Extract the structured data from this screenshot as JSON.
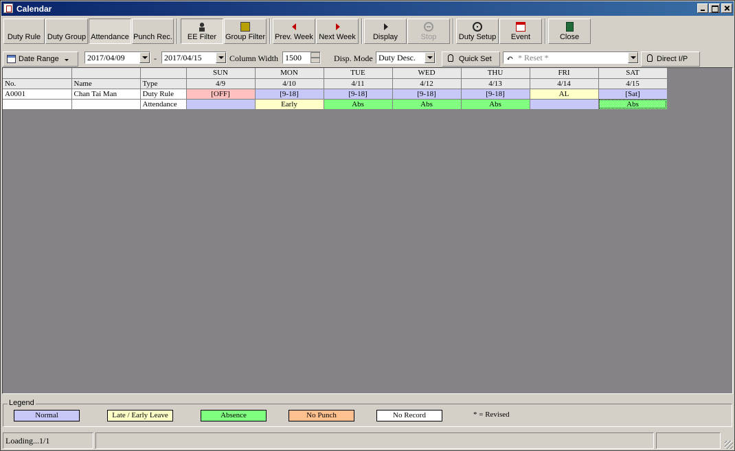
{
  "window": {
    "title": "Calendar"
  },
  "toolbar": {
    "duty_rule": "Duty Rule",
    "duty_group": "Duty Group",
    "attendance": "Attendance",
    "punch_rec": "Punch Rec.",
    "ee_filter": "EE Filter",
    "group_filter": "Group Filter",
    "prev_week": "Prev. Week",
    "next_week": "Next Week",
    "display": "Display",
    "stop": "Stop",
    "duty_setup": "Duty Setup",
    "event": "Event",
    "close": "Close"
  },
  "filters": {
    "date_range": "Date Range",
    "date_from": "2017/04/09",
    "date_sep": "-",
    "date_to": "2017/04/15",
    "column_width_label": "Column Width",
    "column_width": "1500",
    "disp_mode_label": "Disp. Mode",
    "disp_mode": "Duty Desc.",
    "quick_set": "Quick Set",
    "reset": "* Reset *",
    "direct_ip": "Direct I/P"
  },
  "grid": {
    "header_labels": {
      "no": "No.",
      "name": "Name",
      "type": "Type"
    },
    "days": [
      {
        "dow": "SUN",
        "date": "4/9"
      },
      {
        "dow": "MON",
        "date": "4/10"
      },
      {
        "dow": "TUE",
        "date": "4/11"
      },
      {
        "dow": "WED",
        "date": "4/12"
      },
      {
        "dow": "THU",
        "date": "4/13"
      },
      {
        "dow": "FRI",
        "date": "4/14"
      },
      {
        "dow": "SAT",
        "date": "4/15"
      }
    ],
    "employee": {
      "no": "A0001",
      "name": "Chan Tai Man",
      "duty_rule_label": "Duty Rule",
      "attendance_label": "Attendance",
      "duty_rule": [
        "[OFF]",
        "[9-18]",
        "[9-18]",
        "[9-18]",
        "[9-18]",
        "AL",
        "[Sat]"
      ],
      "attendance": [
        "",
        "Early",
        "Abs",
        "Abs",
        "Abs",
        "",
        "Abs"
      ]
    }
  },
  "legend": {
    "title": "Legend",
    "normal": "Normal",
    "late_early": "Late / Early Leave",
    "absence": "Absence",
    "no_punch": "No Punch",
    "no_record": "No Record",
    "revised": "* = Revised"
  },
  "status": {
    "loading": "Loading...1/1"
  },
  "colors": {
    "normal": "#c8c8f8",
    "late_early": "#ffffc8",
    "absence": "#80ff80",
    "no_punch": "#ffc090",
    "no_record": "#ffffff",
    "off": "#ffc0c0",
    "grid_bg": "#858388"
  }
}
